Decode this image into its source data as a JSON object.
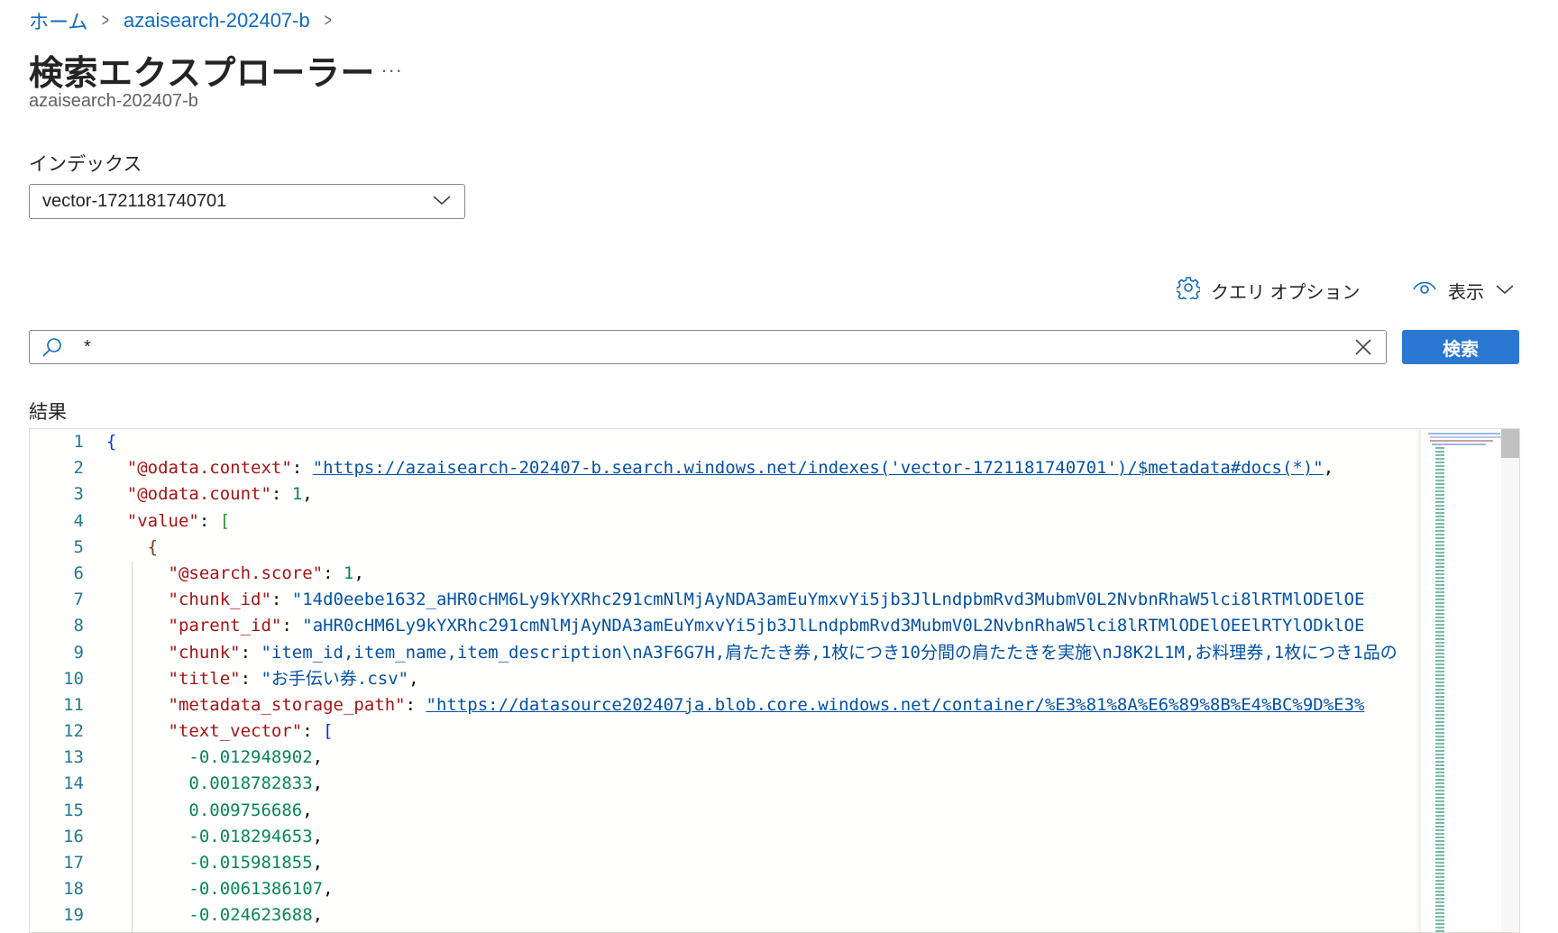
{
  "breadcrumb": {
    "home": "ホーム",
    "service": "azaisearch-202407-b",
    "separator": ">"
  },
  "header": {
    "title": "検索エクスプローラー",
    "more": "...",
    "subtitle": "azaisearch-202407-b"
  },
  "index": {
    "label": "インデックス",
    "selected": "vector-1721181740701"
  },
  "toolbar": {
    "query_options": "クエリ オプション",
    "view": "表示"
  },
  "search": {
    "value": "*",
    "button": "検索"
  },
  "results": {
    "label": "結果",
    "line_numbers": [
      "1",
      "2",
      "3",
      "4",
      "5",
      "6",
      "7",
      "8",
      "9",
      "10",
      "11",
      "12",
      "13",
      "14",
      "15",
      "16",
      "17",
      "18",
      "19"
    ],
    "context_key": "\"@odata.context\"",
    "context_url": "\"https://azaisearch-202407-b.search.windows.net/indexes('vector-1721181740701')/$metadata#docs(*)\"",
    "count_key": "\"@odata.count\"",
    "count_val": "1",
    "value_key": "\"value\"",
    "score_key": "\"@search.score\"",
    "score_val": "1",
    "chunk_id_key": "\"chunk_id\"",
    "chunk_id_val": "\"14d0eebe1632_aHR0cHM6Ly9kYXRhc291cmNlMjAyNDA3amEuYmxvYi5jb3JlLndpbmRvd3MubmV0L2NvbnRhaW5lci8lRTMlODElOE",
    "parent_id_key": "\"parent_id\"",
    "parent_id_val": "\"aHR0cHM6Ly9kYXRhc291cmNlMjAyNDA3amEuYmxvYi5jb3JlLndpbmRvd3MubmV0L2NvbnRhaW5lci8lRTMlODElOEElRTYlODklOE",
    "chunk_key": "\"chunk\"",
    "chunk_val": "\"item_id,item_name,item_description\\nA3F6G7H,肩たたき券,1枚につき10分間の肩たたきを実施\\nJ8K2L1M,お料理券,1枚につき1品の",
    "title_key": "\"title\"",
    "title_val": "\"お手伝い券.csv\"",
    "path_key": "\"metadata_storage_path\"",
    "path_val": "\"https://datasource202407ja.blob.core.windows.net/container/%E3%81%8A%E6%89%8B%E4%BC%9D%E3%",
    "vector_key": "\"text_vector\"",
    "vector_values": [
      "-0.012948902",
      "0.0018782833",
      "0.009756686",
      "-0.018294653",
      "-0.015981855",
      "-0.0061386107",
      "-0.024623688"
    ]
  }
}
